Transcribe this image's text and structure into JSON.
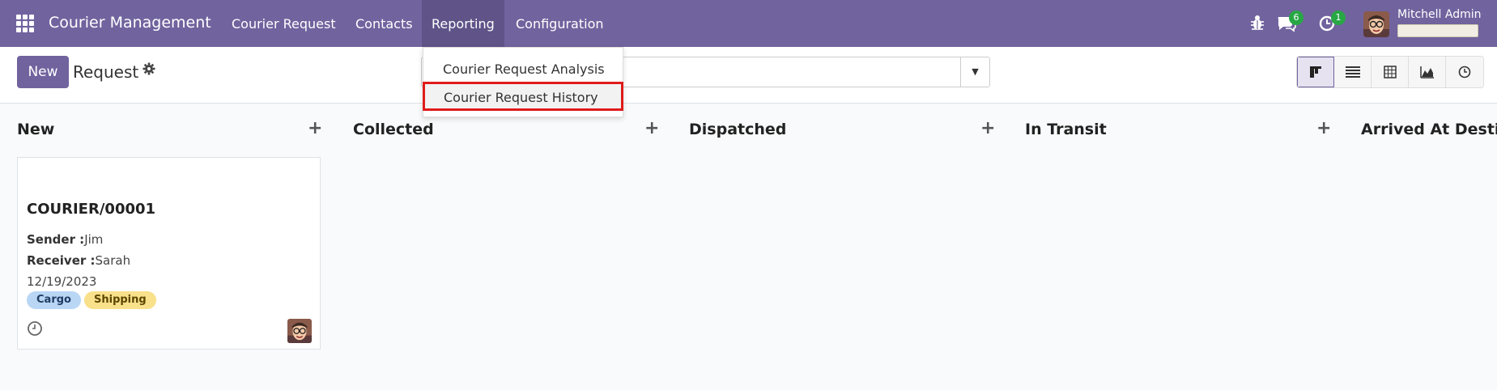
{
  "navbar": {
    "brand": "Courier Management",
    "menu": [
      "Courier Request",
      "Contacts",
      "Reporting",
      "Configuration"
    ],
    "active_menu": "Reporting",
    "messages_count": "6",
    "activities_count": "1",
    "user_name": "Mitchell Admin"
  },
  "control_panel": {
    "new_label": "New",
    "breadcrumb": "Request",
    "search_placeholder": ""
  },
  "reporting_dropdown": {
    "items": [
      "Courier Request Analysis",
      "Courier Request History"
    ],
    "highlighted": "Courier Request History"
  },
  "kanban": {
    "columns": [
      "New",
      "Collected",
      "Dispatched",
      "In Transit",
      "Arrived At Destin"
    ],
    "card": {
      "title": "COURIER/00001",
      "sender_label": "Sender :",
      "sender": "Jim",
      "receiver_label": "Receiver :",
      "receiver": "Sarah",
      "date": "12/19/2023",
      "tags": [
        "Cargo",
        "Shipping"
      ]
    }
  },
  "colors": {
    "navbar": "#71639e",
    "highlight_box": "#e01b1b",
    "tag_cargo": "#b9d6f5",
    "tag_shipping": "#f9e08a",
    "badge": "#28a745"
  }
}
